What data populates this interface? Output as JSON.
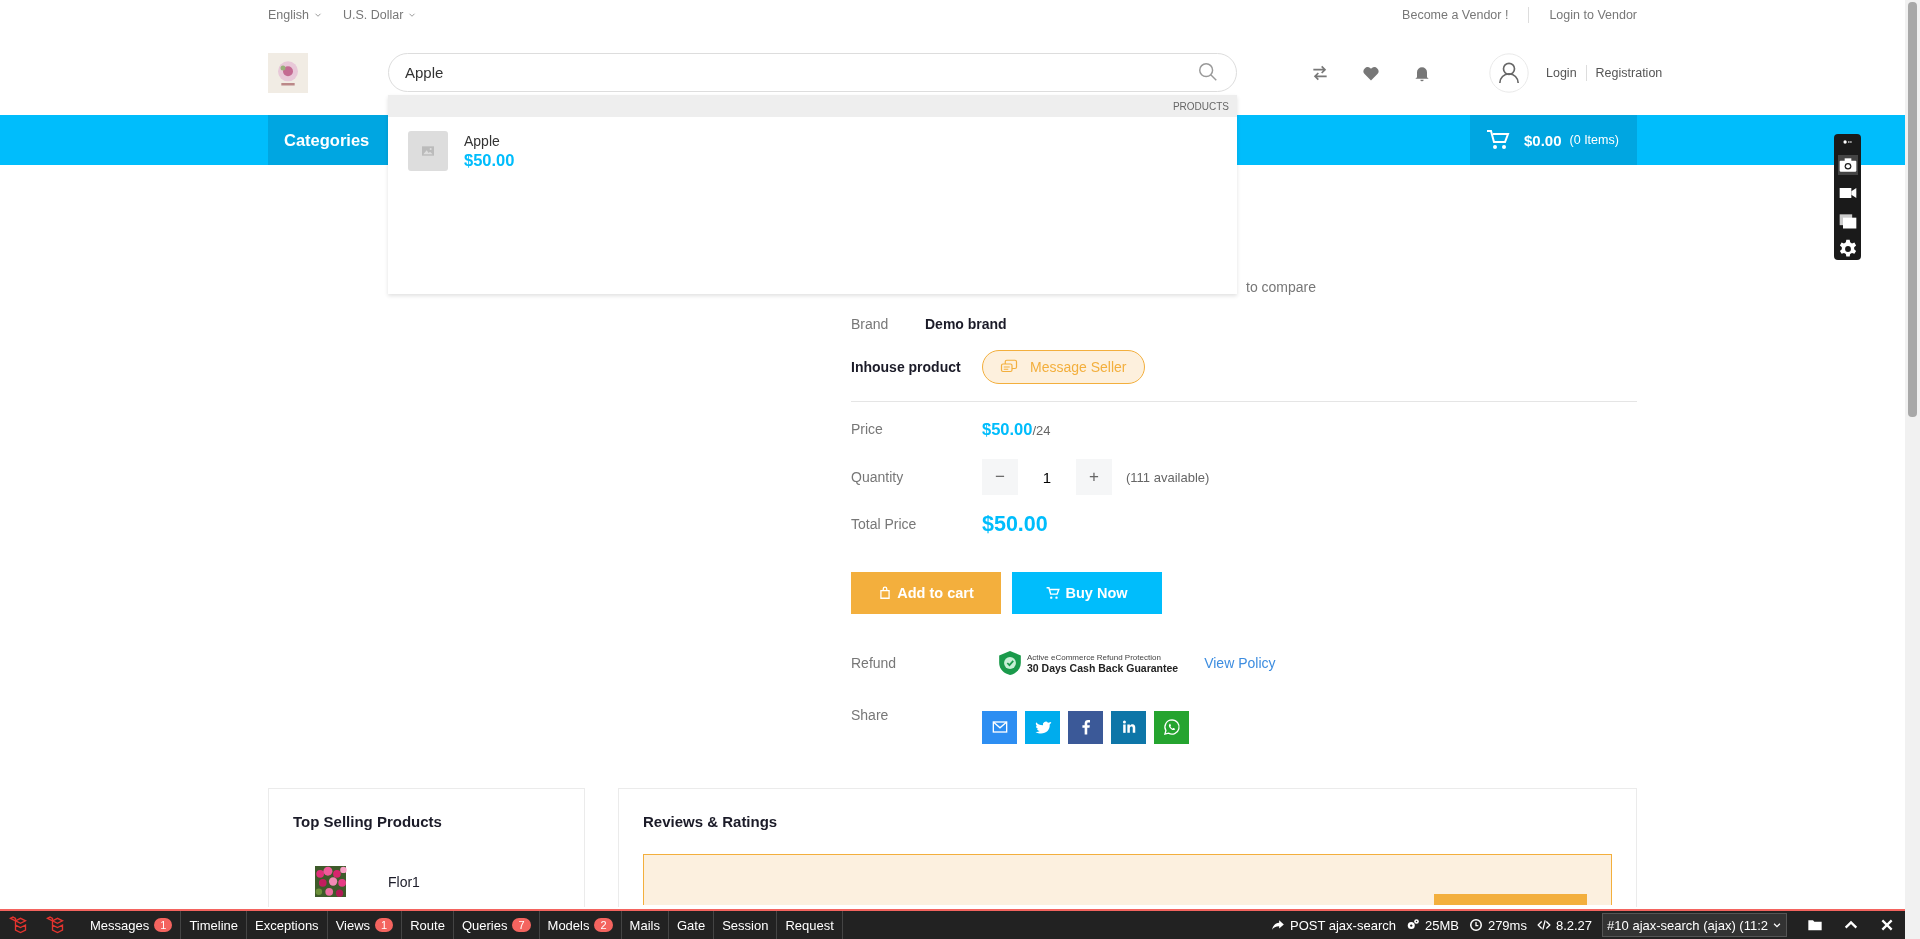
{
  "top_bar": {
    "language": "English",
    "currency": "U.S. Dollar",
    "links": [
      "Become a Vendor !",
      "Login to Vendor"
    ]
  },
  "header": {
    "search": {
      "value": "Apple"
    },
    "account_links": [
      "Login",
      "Registration"
    ]
  },
  "nav": {
    "categories": "Categories",
    "cart": {
      "total": "$0.00",
      "count": "(0 Items)"
    }
  },
  "search_dropdown": {
    "section_label": "PRODUCTS",
    "results": [
      {
        "name": "Apple",
        "price": "$50.00"
      }
    ]
  },
  "product": {
    "compare_text": "to compare",
    "brand": {
      "label": "Brand",
      "value": "Demo brand"
    },
    "seller": {
      "label": "Inhouse product",
      "button": "Message Seller"
    },
    "price": {
      "label": "Price",
      "value": "$50.00",
      "unit": "/24"
    },
    "quantity": {
      "label": "Quantity",
      "decrement": "−",
      "value": "1",
      "increment": "+",
      "available": "(111 available)"
    },
    "total": {
      "label": "Total Price",
      "value": "$50.00"
    },
    "buttons": [
      {
        "kind": "cart",
        "label": "Add to cart"
      },
      {
        "kind": "buy",
        "label": "Buy Now"
      }
    ],
    "refund": {
      "label": "Refund",
      "badge_caption": "Active eCommerce Refund Protection",
      "badge_title": "30 Days Cash Back Guarantee",
      "link": "View Policy"
    },
    "share": {
      "label": "Share",
      "networks": [
        {
          "kind": "email"
        },
        {
          "kind": "twitter"
        },
        {
          "kind": "facebook"
        },
        {
          "kind": "linkedin"
        },
        {
          "kind": "whatsapp"
        }
      ]
    }
  },
  "top_selling": {
    "title": "Top Selling Products",
    "items": [
      {
        "name": "Flor1",
        "kind": "picture"
      }
    ]
  },
  "reviews": {
    "title": "Reviews & Ratings"
  },
  "debug_bar": {
    "tabs": [
      {
        "label": "Messages",
        "badge": "1"
      },
      {
        "label": "Timeline"
      },
      {
        "label": "Exceptions"
      },
      {
        "label": "Views",
        "badge": "1"
      },
      {
        "label": "Route"
      },
      {
        "label": "Queries",
        "badge": "7"
      },
      {
        "label": "Models",
        "badge": "2"
      },
      {
        "label": "Mails"
      },
      {
        "label": "Gate"
      },
      {
        "label": "Session"
      },
      {
        "label": "Request"
      }
    ],
    "request": "POST ajax-search",
    "memory": "25MB",
    "time": "279ms",
    "version": "8.2.27",
    "selected_request": "#10 ajax-search (ajax) (11:2"
  }
}
